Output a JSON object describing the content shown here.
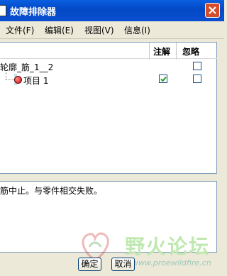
{
  "window": {
    "title": "故障排除器"
  },
  "menu": [
    {
      "label": "文件(F)"
    },
    {
      "label": "编辑(E)"
    },
    {
      "label": "视图(V)"
    },
    {
      "label": "信息(I)"
    }
  ],
  "tree": {
    "columns": {
      "annotate": "注解",
      "ignore": "忽略"
    },
    "root_label": "轮廓_筋_1__2",
    "items": [
      {
        "label": "项目 1",
        "annotate_checked": true,
        "ignore_checked": false
      }
    ],
    "root_annotate_checked": false,
    "root_ignore_checked": false
  },
  "message": {
    "text": "筋中止。与零件相交失败。"
  },
  "watermark": {
    "text": "野火论坛",
    "url": "www.proewildfire.cn"
  },
  "buttons": {
    "ok": "确定",
    "cancel": "取消"
  },
  "colors": {
    "title_bar": "#0a4fd1",
    "selection": "#c5e3ea",
    "close": "#d54e2c"
  }
}
